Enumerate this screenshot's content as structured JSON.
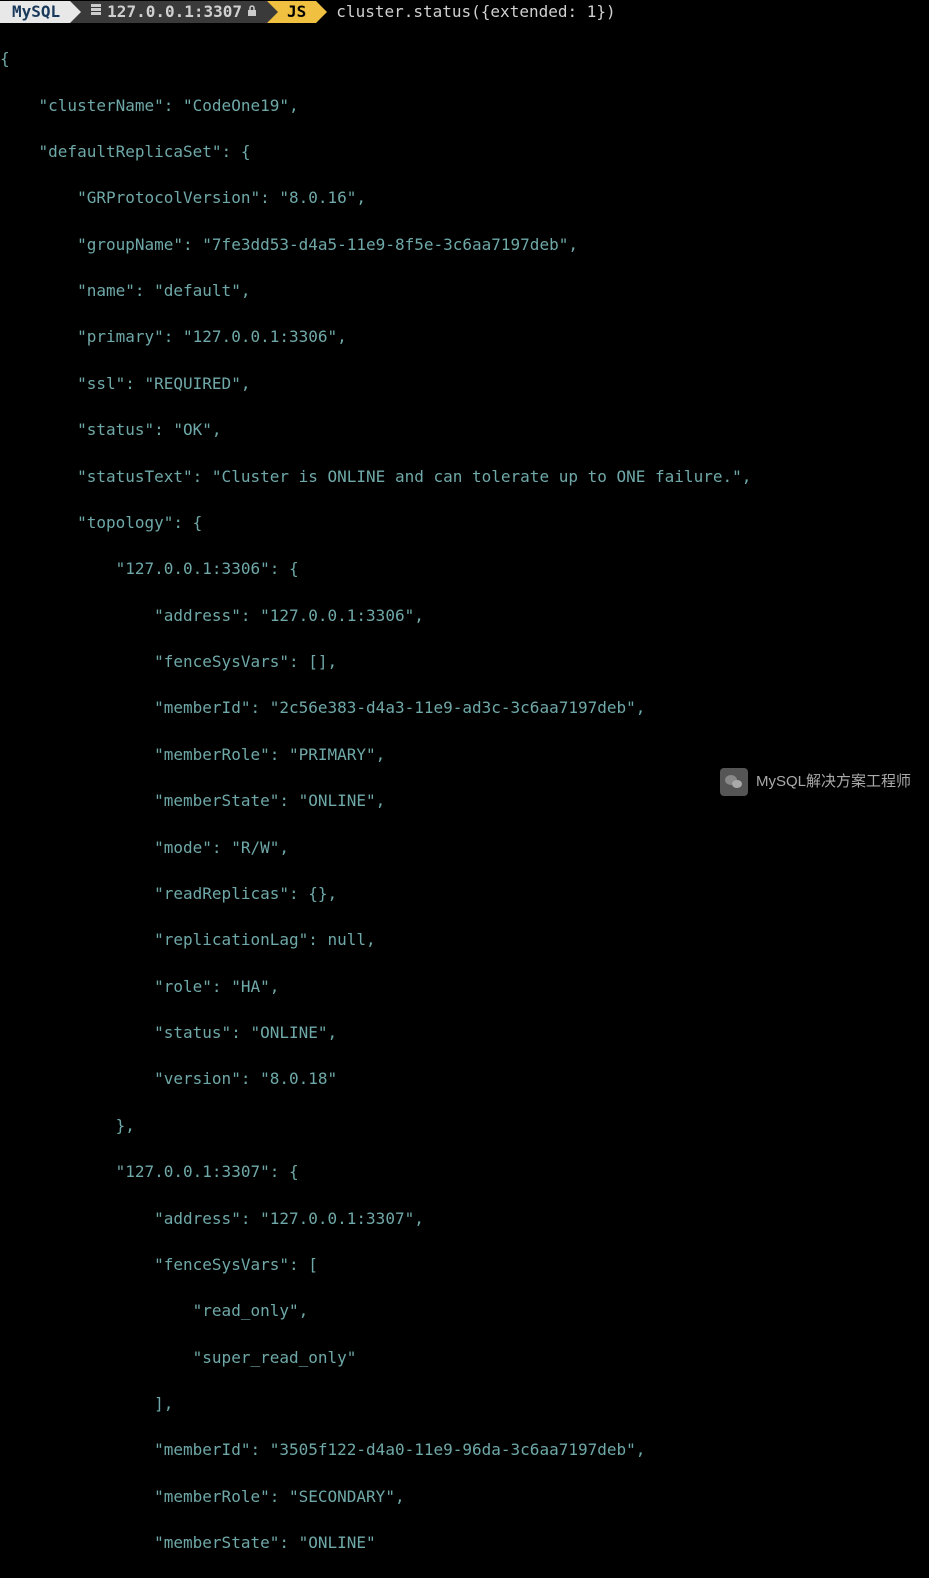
{
  "prompt": {
    "mysql_label": "MySQL",
    "host": "127.0.0.1:3307",
    "mode": "JS",
    "command": "cluster.status({extended: 1})"
  },
  "output": {
    "l1": "{",
    "l2": "    \"clusterName\": \"CodeOne19\",",
    "l3": "    \"defaultReplicaSet\": {",
    "l4": "        \"GRProtocolVersion\": \"8.0.16\",",
    "l5": "        \"groupName\": \"7fe3dd53-d4a5-11e9-8f5e-3c6aa7197deb\",",
    "l6": "        \"name\": \"default\",",
    "l7": "        \"primary\": \"127.0.0.1:3306\",",
    "l8": "        \"ssl\": \"REQUIRED\",",
    "l9": "        \"status\": \"OK\",",
    "l10": "        \"statusText\": \"Cluster is ONLINE and can tolerate up to ONE failure.\",",
    "l11": "        \"topology\": {",
    "l12": "            \"127.0.0.1:3306\": {",
    "l13": "                \"address\": \"127.0.0.1:3306\",",
    "l14": "                \"fenceSysVars\": [],",
    "l15": "                \"memberId\": \"2c56e383-d4a3-11e9-ad3c-3c6aa7197deb\",",
    "l16": "                \"memberRole\": \"PRIMARY\",",
    "l17": "                \"memberState\": \"ONLINE\",",
    "l18": "                \"mode\": \"R/W\",",
    "l19": "                \"readReplicas\": {},",
    "l20": "                \"replicationLag\": null,",
    "l21": "                \"role\": \"HA\",",
    "l22": "                \"status\": \"ONLINE\",",
    "l23": "                \"version\": \"8.0.18\"",
    "l24": "            },",
    "l25": "            \"127.0.0.1:3307\": {",
    "l26": "                \"address\": \"127.0.0.1:3307\",",
    "l27": "                \"fenceSysVars\": [",
    "l28": "                    \"read_only\",",
    "l29": "                    \"super_read_only\"",
    "l30": "                ],",
    "l31": "                \"memberId\": \"3505f122-d4a0-11e9-96da-3c6aa7197deb\",",
    "l32": "                \"memberRole\": \"SECONDARY\",",
    "l33": "                \"memberState\": \"ONLINE\""
  },
  "watermark": {
    "text": "MySQL解决方案工程师"
  }
}
